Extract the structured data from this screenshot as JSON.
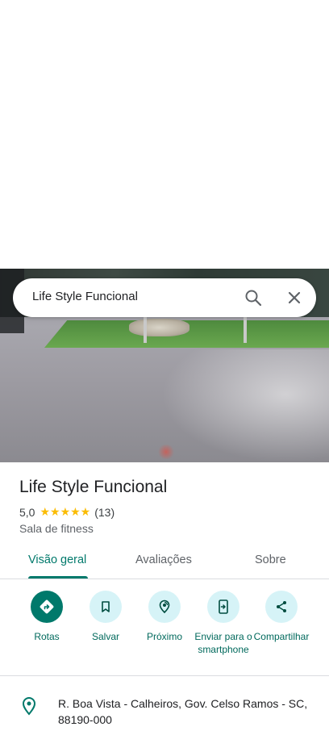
{
  "search": {
    "query": "Life Style Funcional"
  },
  "place": {
    "name": "Life Style Funcional",
    "rating": "5,0",
    "stars": "★★★★★",
    "review_count": "(13)",
    "category": "Sala de fitness",
    "address": "R. Boa Vista - Calheiros, Gov. Celso Ramos - SC, 88190-000"
  },
  "tabs": [
    {
      "label": "Visão geral",
      "active": true
    },
    {
      "label": "Avaliações",
      "active": false
    },
    {
      "label": "Sobre",
      "active": false
    }
  ],
  "actions": [
    {
      "label": "Rotas",
      "icon": "directions-icon"
    },
    {
      "label": "Salvar",
      "icon": "bookmark-icon"
    },
    {
      "label": "Próximo",
      "icon": "nearby-icon"
    },
    {
      "label": "Enviar para o smartphone",
      "icon": "send-to-phone-icon"
    },
    {
      "label": "Compartilhar",
      "icon": "share-icon"
    }
  ],
  "colors": {
    "accent": "#00796b",
    "action_circle": "#d6f3f7",
    "star": "#fbbc04"
  }
}
